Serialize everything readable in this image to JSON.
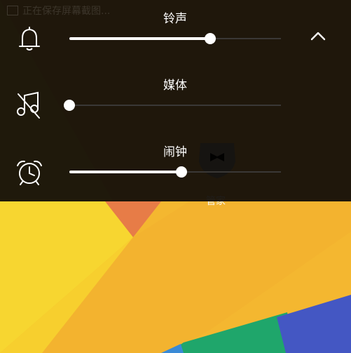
{
  "status_bar": {
    "notice": "正在保存屏幕截图..."
  },
  "volume": {
    "ringtone": {
      "label": "铃声",
      "icon": "bell-icon",
      "level": 0.667
    },
    "media": {
      "label": "媒体",
      "icon": "music-muted-icon",
      "level": 0.0
    },
    "alarm": {
      "label": "闹钟",
      "icon": "alarm-clock-icon",
      "level": 0.53
    }
  },
  "collapse": {
    "icon": "chevron-up-icon"
  },
  "home": {
    "app_label": "管家",
    "app_icon": "butler-icon"
  },
  "colors": {
    "panel_bg": "#0e0b09",
    "slider_fill": "#ffffff",
    "wallpaper_yellow": "#f7d630",
    "wallpaper_orange": "#f3b32f",
    "wallpaper_red": "#e77c47",
    "wallpaper_green": "#1fa66b",
    "wallpaper_blue": "#4457c3"
  }
}
